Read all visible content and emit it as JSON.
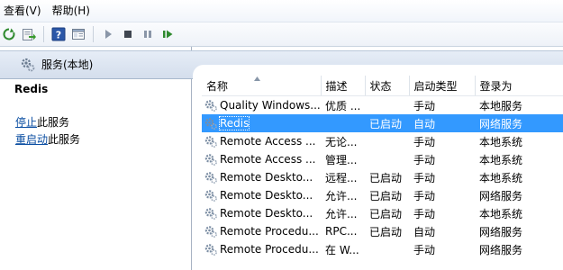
{
  "menu": {
    "items": [
      "查看(V)",
      "帮助(H)"
    ]
  },
  "toolbar": {
    "icons": [
      "refresh-icon",
      "export-icon",
      "help-icon",
      "show-hide-icon",
      "start-icon",
      "stop-icon",
      "pause-icon",
      "resume-icon"
    ]
  },
  "header": {
    "title": "服务(本地)"
  },
  "details": {
    "service_name": "Redis",
    "stop_link": "停止",
    "stop_suffix": "此服务",
    "restart_link": "重启动",
    "restart_suffix": "此服务"
  },
  "table": {
    "columns": [
      "名称",
      "描述",
      "状态",
      "启动类型",
      "登录为"
    ],
    "rows": [
      [
        "Quality Windows...",
        "优质 ...",
        "",
        "手动",
        "本地服务"
      ],
      [
        "Redis",
        "",
        "已启动",
        "自动",
        "网络服务"
      ],
      [
        "Remote Access ...",
        "无论...",
        "",
        "手动",
        "本地系统"
      ],
      [
        "Remote Access ...",
        "管理...",
        "",
        "手动",
        "本地系统"
      ],
      [
        "Remote Deskto...",
        "远程...",
        "已启动",
        "手动",
        "本地系统"
      ],
      [
        "Remote Deskto...",
        "允许...",
        "已启动",
        "手动",
        "网络服务"
      ],
      [
        "Remote Deskto...",
        "允许...",
        "已启动",
        "手动",
        "本地系统"
      ],
      [
        "Remote Procedu...",
        "RPC...",
        "已启动",
        "自动",
        "网络服务"
      ],
      [
        "Remote Procedu...",
        "在 W...",
        "",
        "手动",
        "网络服务"
      ]
    ],
    "selected_row": 1
  },
  "colors": {
    "selection": "#3399ff",
    "link": "#0b4ea2",
    "header_band": "#dbe4f0"
  }
}
